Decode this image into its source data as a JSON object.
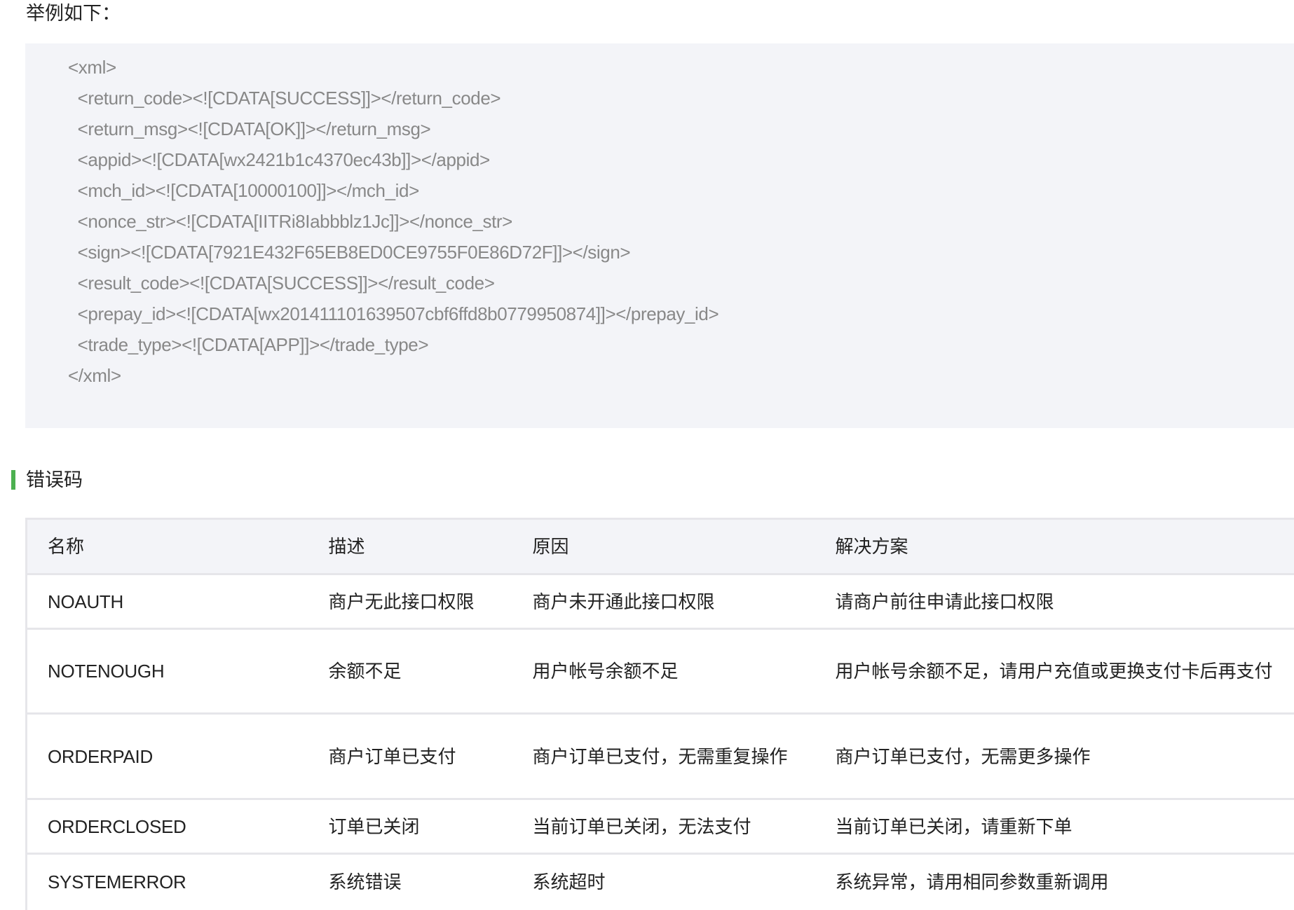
{
  "intro": "举例如下：",
  "code_example": {
    "lines": [
      "<xml>",
      "  <return_code><![CDATA[SUCCESS]]></return_code>",
      "  <return_msg><![CDATA[OK]]></return_msg>",
      "  <appid><![CDATA[wx2421b1c4370ec43b]]></appid>",
      "  <mch_id><![CDATA[10000100]]></mch_id>",
      "  <nonce_str><![CDATA[IITRi8Iabbblz1Jc]]></nonce_str>",
      "  <sign><![CDATA[7921E432F65EB8ED0CE9755F0E86D72F]]></sign>",
      "  <result_code><![CDATA[SUCCESS]]></result_code>",
      "  <prepay_id><![CDATA[wx201411101639507cbf6ffd8b0779950874]]></prepay_id>",
      "  <trade_type><![CDATA[APP]]></trade_type>",
      "</xml>"
    ]
  },
  "section": {
    "title": "错误码",
    "accent_color": "#4cb050"
  },
  "error_table": {
    "headers": [
      "名称",
      "描述",
      "原因",
      "解决方案"
    ],
    "rows": [
      [
        "NOAUTH",
        "商户无此接口权限",
        "商户未开通此接口权限",
        "请商户前往申请此接口权限"
      ],
      [
        "NOTENOUGH",
        "余额不足",
        "用户帐号余额不足",
        "用户帐号余额不足，请用户充值或更换支付卡后再支付"
      ],
      [
        "ORDERPAID",
        "商户订单已支付",
        "商户订单已支付，无需重复操作",
        "商户订单已支付，无需更多操作"
      ],
      [
        "ORDERCLOSED",
        "订单已关闭",
        "当前订单已关闭，无法支付",
        "当前订单已关闭，请重新下单"
      ],
      [
        "SYSTEMERROR",
        "系统错误",
        "系统超时",
        "系统异常，请用相同参数重新调用"
      ]
    ]
  }
}
